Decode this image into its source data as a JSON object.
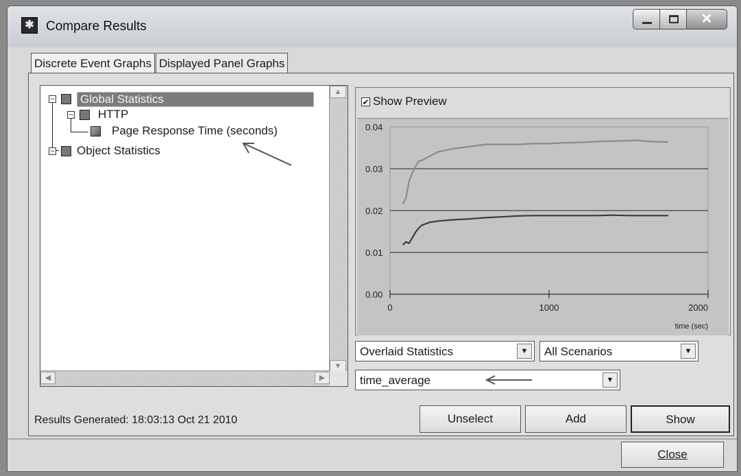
{
  "window": {
    "title": "Compare Results"
  },
  "tabs": [
    {
      "label": "Discrete Event Graphs"
    },
    {
      "label": "Displayed Panel Graphs"
    }
  ],
  "tree": {
    "items": [
      {
        "label": "Global Statistics",
        "selected": true
      },
      {
        "label": "HTTP"
      },
      {
        "label": "Page Response Time (seconds)",
        "checked": true
      },
      {
        "label": "Object Statistics"
      }
    ]
  },
  "preview": {
    "show_preview_label": "Show Preview",
    "show_preview_checked": true
  },
  "chart_data": {
    "type": "line",
    "xlabel": "time (sec)",
    "ylabel": "",
    "xlim": [
      0,
      2000
    ],
    "ylim": [
      0,
      0.04
    ],
    "x_ticks": [
      "0",
      "1000",
      "2000"
    ],
    "y_ticks": [
      "0.00",
      "0.01",
      "0.02",
      "0.03",
      "0.04"
    ],
    "grid": "horizontal",
    "series": [
      {
        "color": "#8a8a8a",
        "x": [
          80,
          100,
          120,
          140,
          160,
          180,
          200,
          250,
          300,
          400,
          500,
          600,
          700,
          800,
          900,
          1000,
          1100,
          1200,
          1300,
          1400,
          1500,
          1550,
          1600,
          1700,
          1750
        ],
        "values": [
          0.0215,
          0.023,
          0.027,
          0.029,
          0.0305,
          0.0318,
          0.032,
          0.033,
          0.034,
          0.0348,
          0.0353,
          0.0358,
          0.0358,
          0.0358,
          0.036,
          0.036,
          0.0362,
          0.0363,
          0.0365,
          0.0366,
          0.0367,
          0.0368,
          0.0366,
          0.0364,
          0.0364
        ]
      },
      {
        "color": "#3a3a3a",
        "x": [
          80,
          100,
          120,
          140,
          160,
          180,
          200,
          250,
          300,
          400,
          500,
          600,
          700,
          800,
          900,
          1000,
          1100,
          1200,
          1300,
          1400,
          1500,
          1600,
          1700,
          1750
        ],
        "values": [
          0.0118,
          0.0125,
          0.0122,
          0.0135,
          0.0148,
          0.0158,
          0.0165,
          0.0172,
          0.0175,
          0.0178,
          0.018,
          0.0183,
          0.0185,
          0.0187,
          0.0188,
          0.0188,
          0.0188,
          0.0188,
          0.0188,
          0.0189,
          0.0188,
          0.0188,
          0.0188,
          0.0188
        ]
      }
    ]
  },
  "controls": {
    "overlay_select": "Overlaid Statistics",
    "scenario_select": "All Scenarios",
    "filter_select": "time_average"
  },
  "footer": {
    "results_generated": "Results Generated: 18:03:13 Oct 21 2010",
    "unselect_label": "Unselect",
    "add_label": "Add",
    "show_label": "Show",
    "close_label": "Close"
  }
}
